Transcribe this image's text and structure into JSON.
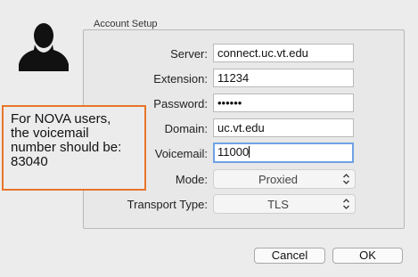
{
  "group_title": "Account Setup",
  "fields": {
    "server": {
      "label": "Server:",
      "value": "connect.uc.vt.edu"
    },
    "extension": {
      "label": "Extension:",
      "value": "11234"
    },
    "password": {
      "label": "Password:",
      "value": "••••••"
    },
    "domain": {
      "label": "Domain:",
      "value": "uc.vt.edu"
    },
    "voicemail": {
      "label": "Voicemail:",
      "value": "11000"
    }
  },
  "popups": {
    "mode": {
      "label": "Mode:",
      "value": "Proxied"
    },
    "transport": {
      "label": "Transport Type:",
      "value": "TLS"
    }
  },
  "note": {
    "lines": [
      "For NOVA users,",
      "the voicemail",
      "number should be:",
      "83040"
    ],
    "border_color": "#e8752a"
  },
  "buttons": {
    "cancel": "Cancel",
    "ok": "OK"
  },
  "icons": {
    "avatar": "user-silhouette-icon",
    "popup_arrows": "chevron-updown-icon"
  }
}
